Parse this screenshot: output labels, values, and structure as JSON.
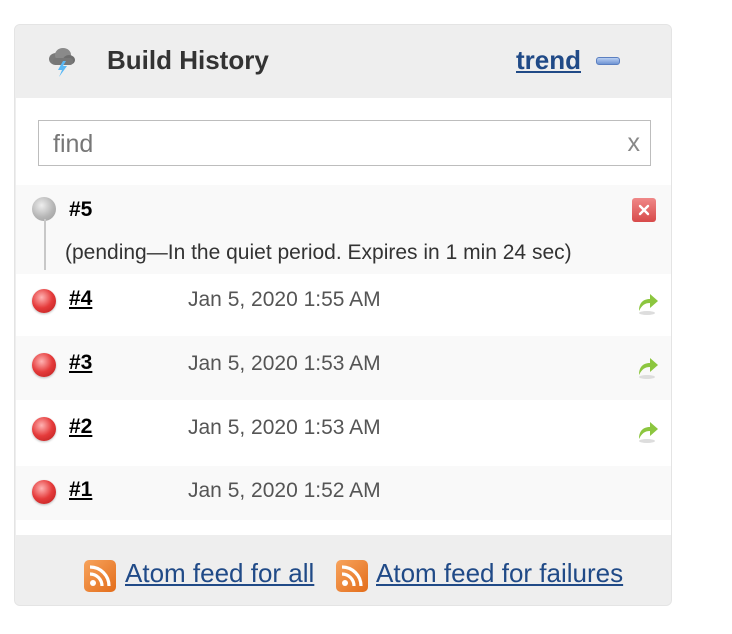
{
  "header": {
    "title": "Build History",
    "trend_label": "trend",
    "icon": "weather-stormy-icon",
    "collapse_icon": "minus-icon"
  },
  "search": {
    "placeholder": "find",
    "value": "",
    "clear_label": "x"
  },
  "pending": {
    "number": "#5",
    "status_icon": "grey-ball-icon",
    "message": "(pending—In the quiet period. Expires in 1 min 24 sec)",
    "cancel_icon": "cancel-icon"
  },
  "builds": [
    {
      "number": "#4",
      "date": "Jan 5, 2020 1:55 AM",
      "status": "failed",
      "has_console": true
    },
    {
      "number": "#3",
      "date": "Jan 5, 2020 1:53 AM",
      "status": "failed",
      "has_console": true
    },
    {
      "number": "#2",
      "date": "Jan 5, 2020 1:53 AM",
      "status": "failed",
      "has_console": true
    },
    {
      "number": "#1",
      "date": "Jan 5, 2020 1:52 AM",
      "status": "failed",
      "has_console": false
    }
  ],
  "footer": {
    "feed_all_label": "Atom feed for all",
    "feed_failures_label": "Atom feed for failures"
  },
  "colors": {
    "link": "#204a87",
    "failed": "#e53b3b",
    "pending": "#b6b6b6",
    "panel_bg": "#eeeeee"
  }
}
